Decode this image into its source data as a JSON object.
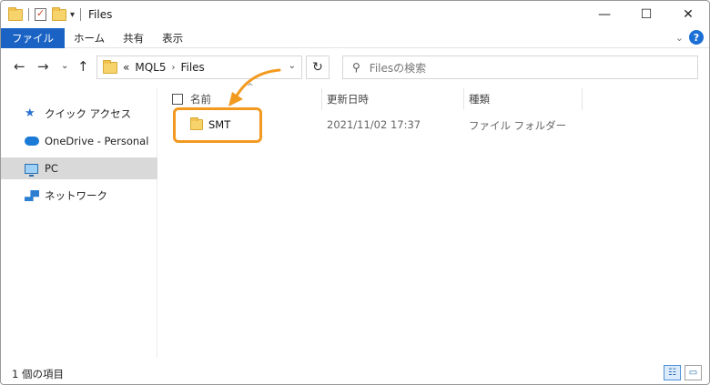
{
  "window": {
    "title": "Files"
  },
  "window_controls": {
    "minimize": "—",
    "maximize": "☐",
    "close": "✕"
  },
  "ribbon": {
    "tabs": [
      "ファイル",
      "ホーム",
      "共有",
      "表示"
    ],
    "collapse": "⌄",
    "help": "?"
  },
  "nav": {
    "back": "←",
    "forward": "→",
    "recent": "⌄",
    "up": "↑",
    "refresh": "↻"
  },
  "address": {
    "overflow": "«",
    "crumbs": [
      "MQL5",
      "Files"
    ],
    "sep": "›",
    "dropdown": "⌄"
  },
  "search": {
    "placeholder": "Filesの検索",
    "glass": "⚲"
  },
  "sidebar": {
    "items": [
      {
        "label": "クイック アクセス",
        "icon": "star-icon"
      },
      {
        "label": "OneDrive - Personal",
        "icon": "cloud-icon"
      },
      {
        "label": "PC",
        "icon": "computer-icon",
        "selected": true
      },
      {
        "label": "ネットワーク",
        "icon": "network-icon"
      }
    ]
  },
  "columns": {
    "name": "名前",
    "date": "更新日時",
    "type": "種類",
    "sort": "^"
  },
  "rows": [
    {
      "name": "SMT",
      "date": "2021/11/02 17:37",
      "type": "ファイル フォルダー"
    }
  ],
  "status": {
    "count": "1 個の項目"
  },
  "colors": {
    "accent": "#1a63c5",
    "highlight": "#f29a20"
  }
}
